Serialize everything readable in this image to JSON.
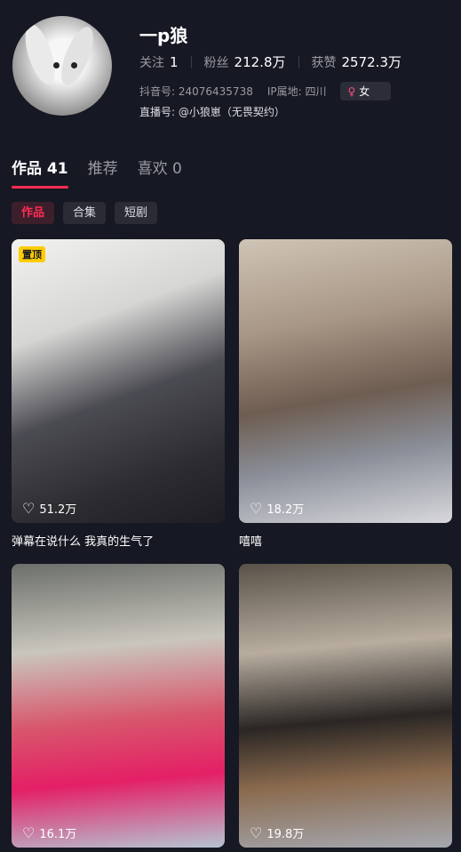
{
  "profile": {
    "name": "一p狼",
    "stats": [
      {
        "label": "关注",
        "value": "1"
      },
      {
        "label": "粉丝",
        "value": "212.8万"
      },
      {
        "label": "获赞",
        "value": "2572.3万"
      }
    ],
    "douyin_id": "抖音号: 24076435738",
    "ip_location": "IP属地: 四川",
    "gender_symbol": "♀",
    "gender_label": "女",
    "live_id": "直播号: @小狼崽（无畏契约）"
  },
  "tabs": [
    {
      "label": "作品 41",
      "active": true
    },
    {
      "label": "推荐",
      "active": false
    },
    {
      "label": "喜欢 0",
      "active": false
    }
  ],
  "chips": [
    {
      "label": "作品",
      "active": true
    },
    {
      "label": "合集",
      "active": false
    },
    {
      "label": "短剧",
      "active": false
    }
  ],
  "videos": [
    {
      "pinned_label": "置顶",
      "likes": "51.2万",
      "caption": "弹幕在说什么 我真的生气了"
    },
    {
      "pinned_label": "",
      "likes": "18.2万",
      "caption": "嘻嘻"
    },
    {
      "pinned_label": "",
      "likes": "16.1万",
      "caption": ""
    },
    {
      "pinned_label": "",
      "likes": "19.8万",
      "caption": ""
    }
  ],
  "icons": {
    "like": "heart-outline-icon",
    "gender": "female-icon"
  },
  "colors": {
    "background": "#161823",
    "accent": "#fe2c55",
    "pin": "#fecc00"
  }
}
